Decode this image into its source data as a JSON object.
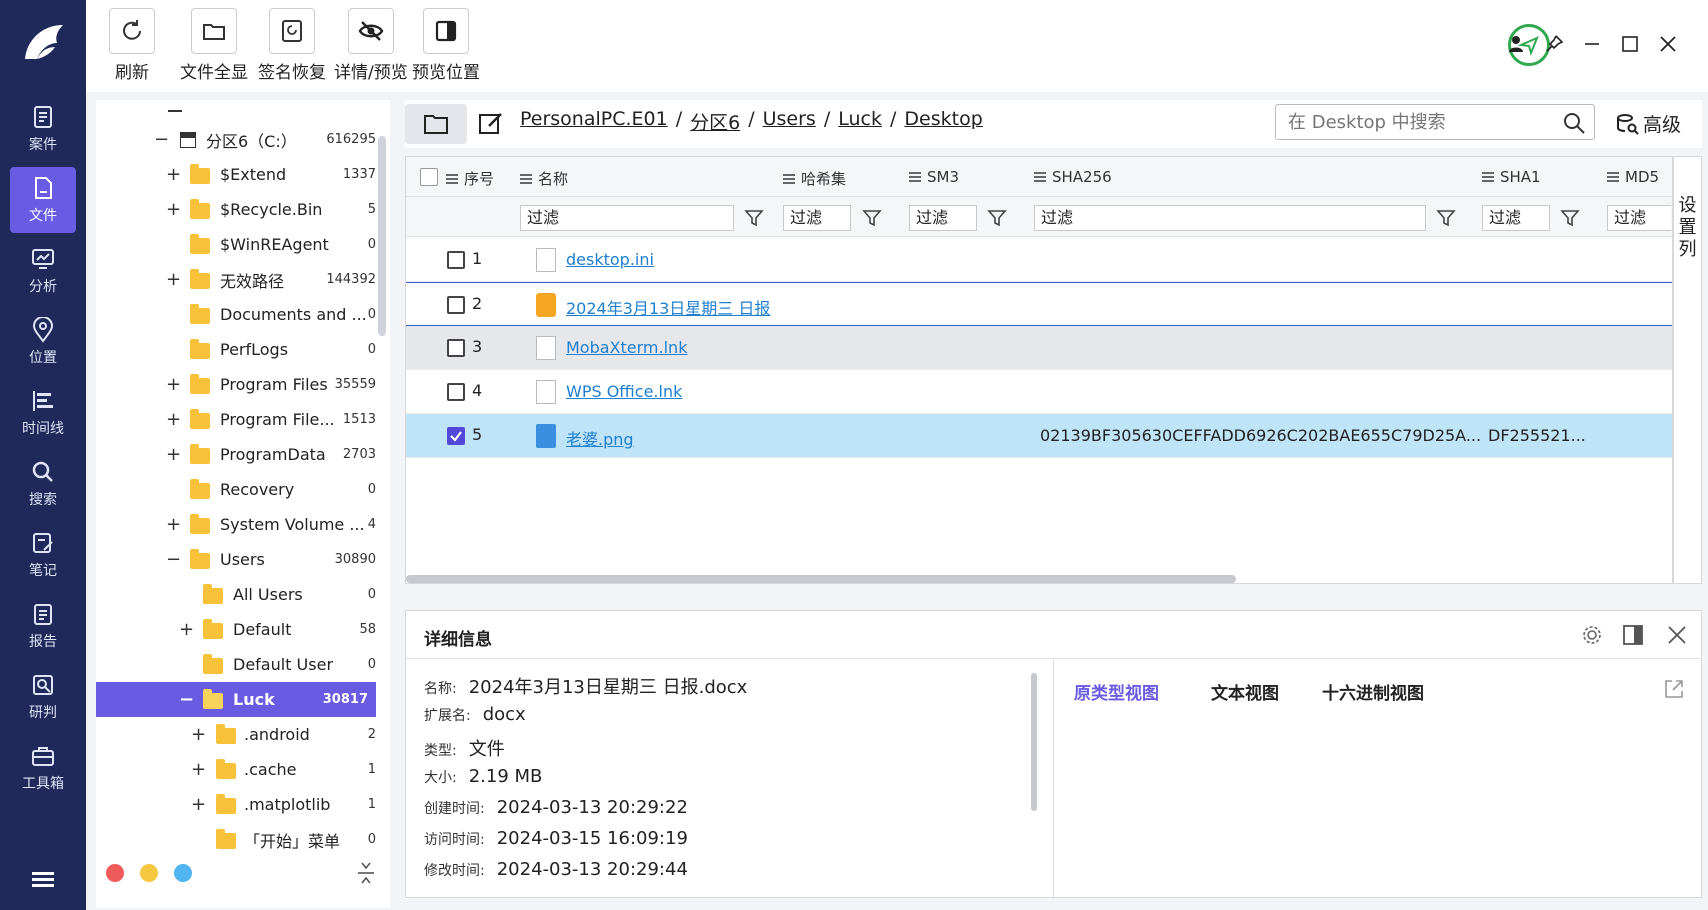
{
  "rail": {
    "items": [
      {
        "label": "案件",
        "icon": "clipboard-icon"
      },
      {
        "label": "文件",
        "icon": "file-icon"
      },
      {
        "label": "分析",
        "icon": "monitor-chart-icon"
      },
      {
        "label": "位置",
        "icon": "location-pin-icon"
      },
      {
        "label": "时间线",
        "icon": "timeline-icon"
      },
      {
        "label": "搜索",
        "icon": "search-icon"
      },
      {
        "label": "笔记",
        "icon": "note-icon"
      },
      {
        "label": "报告",
        "icon": "report-icon"
      },
      {
        "label": "研判",
        "icon": "analysis-icon"
      },
      {
        "label": "工具箱",
        "icon": "toolbox-icon"
      }
    ],
    "active": "文件"
  },
  "toolbar": {
    "refresh": "刷新",
    "show_all": "文件全显",
    "sig_restore": "签名恢复",
    "details_preview": "详情/预览",
    "preview_position": "预览位置"
  },
  "tree": {
    "rows": [
      {
        "exp": "−",
        "label": "分区6（C:）",
        "count": "616295"
      },
      {
        "exp": "+",
        "label": "$Extend",
        "count": "1337"
      },
      {
        "exp": "+",
        "label": "$Recycle.Bin",
        "count": "5"
      },
      {
        "exp": "",
        "label": "$WinREAgent",
        "count": "0"
      },
      {
        "exp": "+",
        "label": "无效路径",
        "count": "144392"
      },
      {
        "exp": "",
        "label": "Documents and ...",
        "count": "0"
      },
      {
        "exp": "",
        "label": "PerfLogs",
        "count": "0"
      },
      {
        "exp": "+",
        "label": "Program Files",
        "count": "35559"
      },
      {
        "exp": "+",
        "label": "Program File...",
        "count": "1513"
      },
      {
        "exp": "+",
        "label": "ProgramData",
        "count": "2703"
      },
      {
        "exp": "",
        "label": "Recovery",
        "count": "0"
      },
      {
        "exp": "+",
        "label": "System Volume ...",
        "count": "4"
      },
      {
        "exp": "−",
        "label": "Users",
        "count": "30890"
      },
      {
        "exp": "",
        "label": "All Users",
        "count": "0"
      },
      {
        "exp": "+",
        "label": "Default",
        "count": "58"
      },
      {
        "exp": "",
        "label": "Default User",
        "count": "0"
      },
      {
        "exp": "−",
        "label": "Luck",
        "count": "30817"
      },
      {
        "exp": "+",
        "label": ".android",
        "count": "2"
      },
      {
        "exp": "+",
        "label": ".cache",
        "count": "1"
      },
      {
        "exp": "+",
        "label": ".matplotlib",
        "count": "1"
      },
      {
        "exp": "",
        "label": "「开始」菜单",
        "count": "0"
      }
    ]
  },
  "path": {
    "crumbs": [
      "PersonalPC.E01",
      "分区6",
      "Users",
      "Luck",
      "Desktop"
    ],
    "sep": "/",
    "search_placeholder": "在 Desktop 中搜索",
    "advanced": "高级"
  },
  "grid": {
    "headers": {
      "num": "序号",
      "name": "名称",
      "hashset": "哈希集",
      "sm3": "SM3",
      "sha256": "SHA256",
      "sha1": "SHA1",
      "md5": "MD5"
    },
    "filter_placeholder": "过滤",
    "rows": [
      {
        "num": "1",
        "name": "desktop.ini",
        "sha256": "",
        "sha1": ""
      },
      {
        "num": "2",
        "name": "2024年3月13日星期三 日报",
        "sha256": "",
        "sha1": ""
      },
      {
        "num": "3",
        "name": "MobaXterm.lnk",
        "sha256": "",
        "sha1": ""
      },
      {
        "num": "4",
        "name": "WPS Office.lnk",
        "sha256": "",
        "sha1": ""
      },
      {
        "num": "5",
        "name": "老婆.png",
        "sha256": "02139BF305630CEFFADD6926C202BAE655C79D25A...",
        "sha1": "DF255521..."
      }
    ],
    "set_columns": "设置列"
  },
  "detail": {
    "title": "详细信息",
    "props": [
      {
        "k": "名称:",
        "v": "2024年3月13日星期三 日报.docx"
      },
      {
        "k": "扩展名:",
        "v": "docx"
      },
      {
        "k": "类型:",
        "v": "文件"
      },
      {
        "k": "大小:",
        "v": "2.19 MB"
      },
      {
        "k": "创建时间:",
        "v": "2024-03-13 20:29:22"
      },
      {
        "k": "访问时间:",
        "v": "2024-03-15 16:09:19"
      },
      {
        "k": "修改时间:",
        "v": "2024-03-13 20:29:44"
      }
    ],
    "tabs": [
      "原类型视图",
      "文本视图",
      "十六进制视图"
    ]
  },
  "colors": {
    "rail": "#1f2a5a",
    "accent": "#6a5be3",
    "link": "#1e7fd1",
    "selected_row": "#bfe4f8",
    "status_ok": "#2fa84f"
  }
}
